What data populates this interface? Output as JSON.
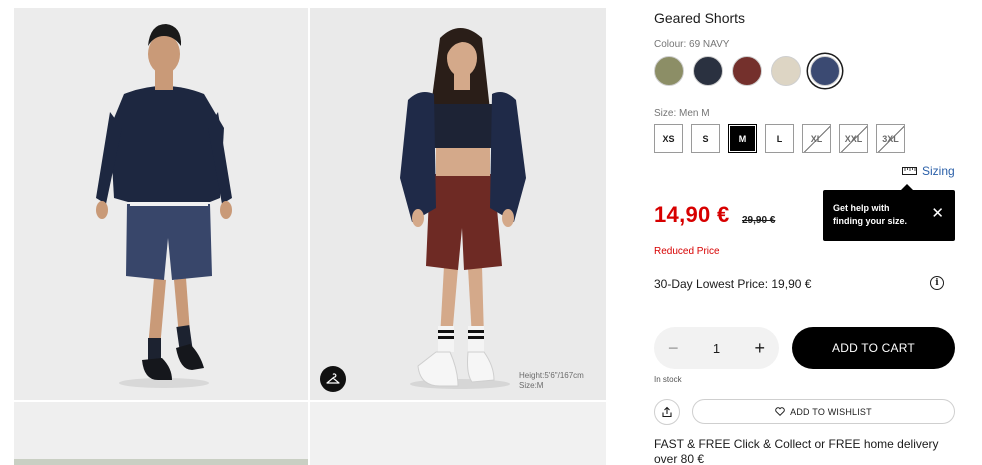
{
  "gallery": {
    "model_info": {
      "height": "Height:5'6\"/167cm",
      "size": "Size:M"
    },
    "hanger_icon": "hanger-icon"
  },
  "product": {
    "title": "Geared Shorts",
    "colour_label": "Colour: 69 NAVY",
    "colours": [
      {
        "name": "olive",
        "hex": "#8c8e66",
        "selected": false
      },
      {
        "name": "dark-navy",
        "hex": "#2a3140",
        "selected": false
      },
      {
        "name": "brown",
        "hex": "#74302c",
        "selected": false
      },
      {
        "name": "beige",
        "hex": "#ddd5c4",
        "selected": false
      },
      {
        "name": "navy",
        "hex": "#3b4a72",
        "selected": true
      }
    ],
    "size_label": "Size: Men M",
    "sizes": [
      {
        "label": "XS",
        "state": "available"
      },
      {
        "label": "S",
        "state": "available"
      },
      {
        "label": "M",
        "state": "selected"
      },
      {
        "label": "L",
        "state": "available"
      },
      {
        "label": "XL",
        "state": "sold-out"
      },
      {
        "label": "XXL",
        "state": "sold-out"
      },
      {
        "label": "3XL",
        "state": "sold-out"
      }
    ],
    "sizing_link": "Sizing",
    "tooltip": {
      "line1": "Get help with",
      "line2": "finding your size."
    },
    "price": "14,90 €",
    "old_price": "29,90 €",
    "reduced_label": "Reduced Price",
    "lowest_price": "30-Day Lowest Price: 19,90 €",
    "quantity": "1",
    "add_to_cart": "ADD TO CART",
    "stock": "In stock",
    "wishlist": "ADD TO WISHLIST",
    "delivery": "FAST & FREE Click & Collect or FREE home delivery over 80 €"
  },
  "colors": {
    "accent": "#d70000",
    "link": "#2a5fa8",
    "button": "#000000"
  }
}
